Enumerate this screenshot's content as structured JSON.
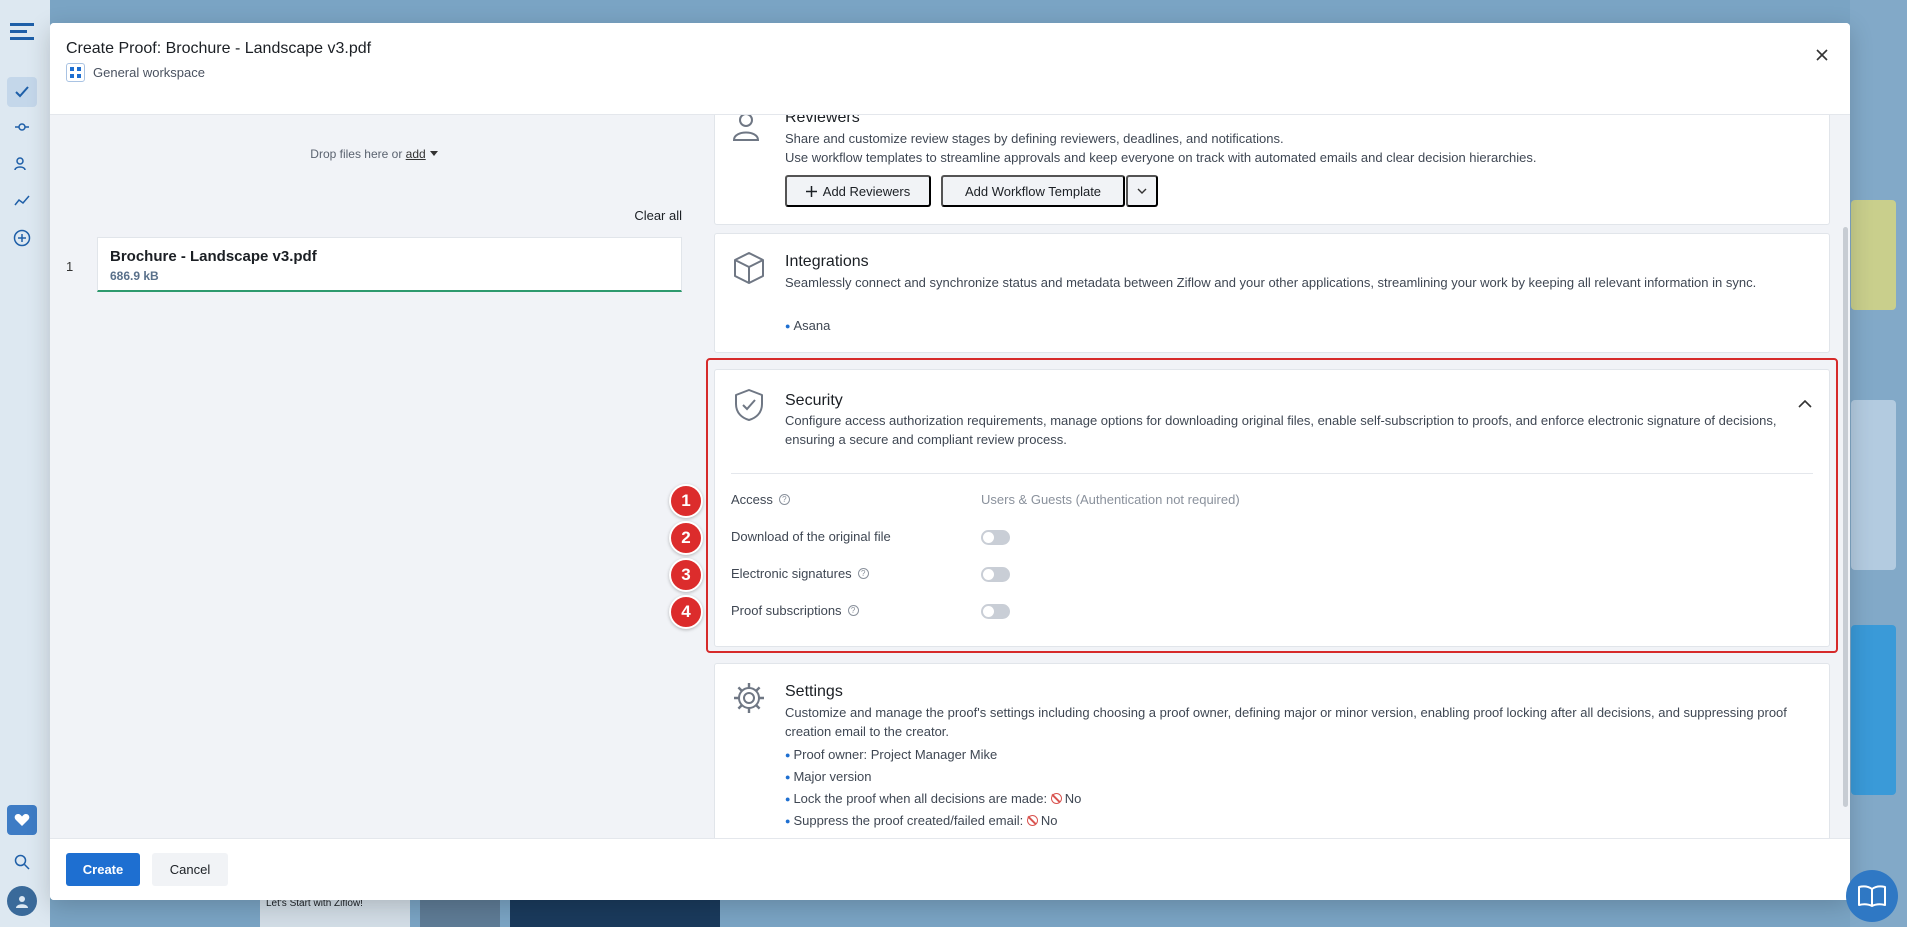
{
  "modal": {
    "title": "Create Proof:  Brochure - Landscape v3.pdf",
    "workspace": "General workspace"
  },
  "upload": {
    "drop_text": "Drop files here or",
    "add_link": "add",
    "clear_all": "Clear all",
    "files": [
      {
        "index": "1",
        "name": "Brochure - Landscape v3.pdf",
        "size": "686.9 kB"
      }
    ]
  },
  "sections": {
    "reviewers": {
      "title": "Reviewers",
      "desc1": "Share and customize review stages by defining reviewers, deadlines, and notifications.",
      "desc2": "Use workflow templates to streamline approvals and keep everyone on track with automated emails and clear decision hierarchies.",
      "add_reviewers": "Add Reviewers",
      "add_workflow": "Add Workflow Template"
    },
    "integrations": {
      "title": "Integrations",
      "desc": "Seamlessly connect and synchronize status and metadata between Ziflow and your other applications, streamlining your work by keeping all relevant information in sync.",
      "items": [
        "Asana"
      ]
    },
    "security": {
      "title": "Security",
      "desc": "Configure access authorization requirements, manage options for downloading original files, enable self-subscription to proofs, and enforce electronic signature of decisions, ensuring a secure and compliant review process.",
      "access_label": "Access",
      "access_value": "Users & Guests (Authentication not required)",
      "download_label": "Download of the original file",
      "esign_label": "Electronic signatures",
      "subscriptions_label": "Proof subscriptions",
      "toggles": {
        "download": false,
        "esign": false,
        "subscriptions": false
      }
    },
    "settings": {
      "title": "Settings",
      "desc": "Customize and manage the proof's settings including choosing a proof owner, defining major or minor version, enabling proof locking after all decisions, and suppressing proof creation email to the creator.",
      "owner": "Proof owner: Project Manager Mike",
      "version": "Major version",
      "lock_label": "Lock the proof when all decisions are made:",
      "lock_value": "No",
      "suppress_label": "Suppress the proof created/failed email:",
      "suppress_value": "No"
    }
  },
  "annotations": [
    "1",
    "2",
    "3",
    "4"
  ],
  "footer": {
    "create": "Create",
    "cancel": "Cancel"
  },
  "background": {
    "card_title": "Let's Start with Ziflow!"
  },
  "colors": {
    "primary": "#1e6fd1",
    "highlight": "#d62a2a",
    "success": "#2e9a6e"
  }
}
